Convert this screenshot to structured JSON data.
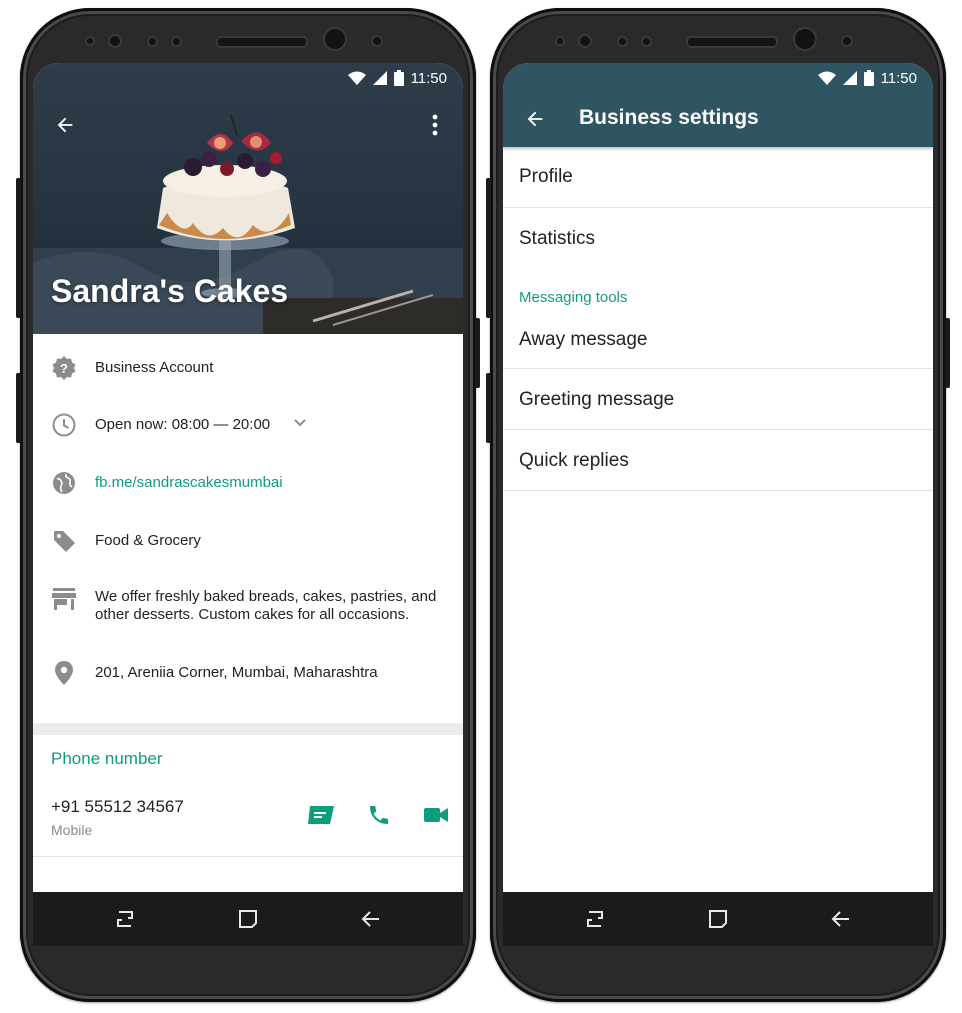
{
  "status": {
    "time": "11:50"
  },
  "profile": {
    "title": "Sandra's Cakes",
    "rows": [
      {
        "icon": "verified-badge-icon",
        "text": "Business Account"
      },
      {
        "icon": "clock-icon",
        "text": "Open now: 08:00 — 20:00"
      },
      {
        "icon": "globe-icon",
        "text": "fb.me/sandrascakesmumbai"
      },
      {
        "icon": "tag-icon",
        "text": "Food & Grocery"
      },
      {
        "icon": "store-icon",
        "text": "We offer freshly baked breads, cakes, pastries, and other desserts. Custom cakes for all occasions."
      },
      {
        "icon": "location-pin-icon",
        "text": "201, Areniia Corner, Mumbai, Maharashtra"
      }
    ],
    "phone_section": {
      "header": "Phone number",
      "number": "+91 55512 34567",
      "type": "Mobile"
    }
  },
  "settings": {
    "title": "Business settings",
    "items_top": [
      "Profile",
      "Statistics"
    ],
    "section_header": "Messaging tools",
    "items_messaging": [
      "Away message",
      "Greeting message",
      "Quick replies"
    ]
  },
  "colors": {
    "accent": "#0f9d7e",
    "appbar": "#2f5563",
    "navbar": "#1b1b1d"
  }
}
